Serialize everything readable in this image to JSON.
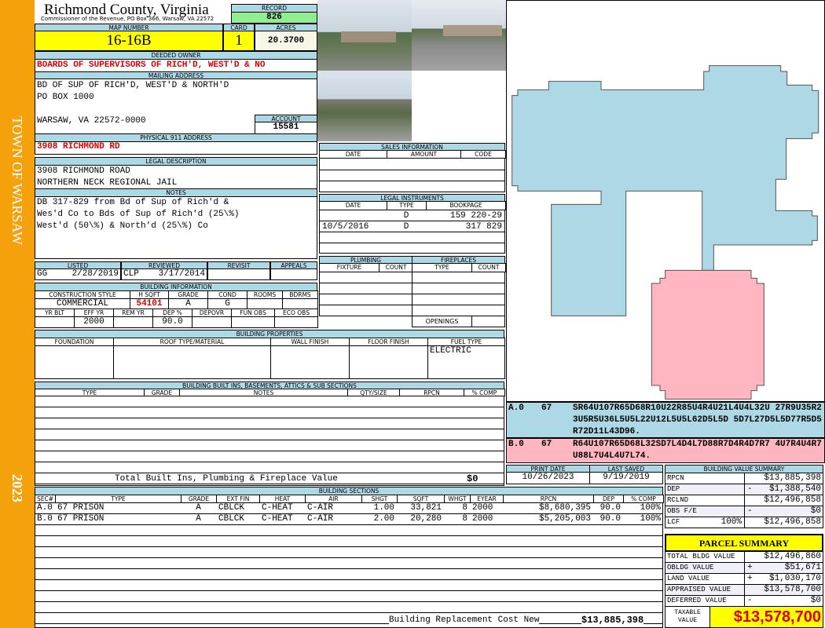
{
  "sidebar": {
    "town": "TOWN OF WARSAW",
    "year": "2023"
  },
  "header": {
    "title": "Richmond County, Virginia",
    "subtitle": "Commissioner of the Revenue, PO Box 366, Warsaw, VA 22572",
    "record_label": "RECORD",
    "record": "826"
  },
  "parcel": {
    "map_label": "MAP NUMBER",
    "map": "16-16B",
    "card_label": "CARD",
    "card": "1",
    "acres_label": "ACRES",
    "acres": "20.3700"
  },
  "owner": {
    "label": "DEEDED OWNER",
    "value": "BOARDS OF SUPERVISORS OF RICH'D, WEST'D & NO"
  },
  "mailing": {
    "label": "MAILING ADDRESS",
    "line1": "BD OF SUP OF RICH'D, WEST'D & NORTH'D",
    "line2": "PO BOX 1000",
    "line3": "WARSAW, VA 22572-0000",
    "account_label": "ACCOUNT",
    "account": "15581"
  },
  "physical": {
    "label": "PHYSICAL 911 ADDRESS",
    "value": "3908 RICHMOND RD"
  },
  "legal": {
    "label": "LEGAL DESCRIPTION",
    "line1": "3908 RICHMOND ROAD",
    "line2": "NORTHERN NECK REGIONAL JAIL"
  },
  "notes": {
    "label": "NOTES",
    "line1": "DB 317-829 from Bd of Sup of Rich'd &",
    "line2": "Wes'd Co to Bds of Sup of Rich'd (25\\%)",
    "line3": "West'd (50\\%) & North'd (25\\%) Co"
  },
  "review": {
    "listed_label": "LISTED",
    "listed_by": "GG",
    "listed_date": "2/28/2019",
    "reviewed_label": "REVIEWED",
    "reviewed_by": "CLP",
    "reviewed_date": "3/17/2014",
    "revisit_label": "REVISIT",
    "appeals_label": "APPEALS"
  },
  "building_info": {
    "label": "BUILDING INFORMATION",
    "h1": [
      "CONSTRUCTION STYLE",
      "H SQFT",
      "GRADE",
      "COND",
      "ROOMS",
      "BDRMS"
    ],
    "v1": [
      "COMMERCIAL",
      "54101",
      "A",
      "G",
      "",
      ""
    ],
    "h2": [
      "YR BLT",
      "EFF YR",
      "REM YR",
      "DEP %",
      "DEPOVR",
      "FUN OBS",
      "ECO OBS"
    ],
    "v2": [
      "",
      "2000",
      "",
      "90.0",
      "",
      "",
      ""
    ]
  },
  "sales": {
    "label": "SALES INFORMATION",
    "headers": [
      "DATE",
      "AMOUNT",
      "CODE"
    ]
  },
  "instruments": {
    "label": "LEGAL INSTRUMENTS",
    "headers": [
      "DATE",
      "TYPE",
      "BOOKPAGE"
    ],
    "rows": [
      [
        "",
        "D",
        "159 220-29"
      ],
      [
        "10/5/2016",
        "D",
        "317 829"
      ]
    ]
  },
  "plumbing": {
    "label": "PLUMBING",
    "headers": [
      "FIXTURE",
      "COUNT"
    ]
  },
  "fireplaces": {
    "label": "FIREPLACES",
    "headers": [
      "TYPE",
      "COUNT"
    ],
    "openings": "OPENINGS"
  },
  "properties": {
    "label": "BUILDING PROPERTIES",
    "headers": [
      "FOUNDATION",
      "ROOF TYPE/MATERIAL",
      "WALL FINISH",
      "FLOOR FINISH",
      "FUEL TYPE"
    ],
    "fuel": "ELECTRIC"
  },
  "builtins": {
    "label": "BUILDING BUILT INS, BASEMENTS, ATTICS & SUB SECTIONS",
    "headers": [
      "TYPE",
      "GRADE",
      "NOTES",
      "QTY/SIZE",
      "RPCN",
      "% COMP"
    ],
    "total_label": "Total Built Ins, Plumbing & Fireplace Value",
    "total": "$0"
  },
  "sections": {
    "label": "BUILDING SECTIONS",
    "headers": [
      "SEC#",
      "TYPE",
      "GRADE",
      "EXT FIN",
      "HEAT",
      "AIR",
      "SHGT",
      "SQFT",
      "WHGT",
      "EYEAR",
      "RPCN",
      "DEP",
      "% COMP"
    ],
    "rows": [
      [
        "A.0",
        "67 PRISON",
        "A",
        "CBLCK",
        "C-HEAT",
        "C-AIR",
        "1.00",
        "33,821",
        "8",
        "2000",
        "$8,680,395",
        "90.0",
        "100%"
      ],
      [
        "B.0",
        "67 PRISON",
        "A",
        "CBLCK",
        "C-HEAT",
        "C-AIR",
        "2.00",
        "20,280",
        "8",
        "2000",
        "$5,205,003",
        "90.0",
        "100%"
      ]
    ],
    "rcn_label": "Building Replacement Cost New",
    "rcn": "$13,885,398"
  },
  "sketch_codes": [
    {
      "sec": "A.0",
      "code": "67",
      "text": "SR64U107R65D68R10U22R85U4R4U21L4U4L32U 27R9U35R23U5R5U36L5U5L22U12L5U5L62D5L5D 5D7L27D5L5D77R5D5R72D11L43D96.",
      "color": "#add8e6"
    },
    {
      "sec": "B.0",
      "code": "67",
      "text": "R64U107R65D68L32SD7L4D4L7D88R7D4R4D7R7 4U7R4U4R7U88L7U4L4U7L74.",
      "color": "#ffb6c1"
    }
  ],
  "dates": {
    "print_label": "PRINT DATE",
    "print": "10/26/2023",
    "saved_label": "LAST SAVED",
    "saved": "9/19/2019"
  },
  "value_summary": {
    "label": "BUILDING VALUE SUMMARY",
    "rows": [
      {
        "k": "RPCN",
        "s": "",
        "v": "$13,885,398"
      },
      {
        "k": "DEP",
        "s": "-",
        "v": "$1,388,540"
      },
      {
        "k": "RCLND",
        "s": "",
        "v": "$12,496,858"
      },
      {
        "k": "OBS F/E",
        "s": "-",
        "v": "$0"
      },
      {
        "k": "LCF",
        "p": "100%",
        "s": "",
        "v": "$12,496,858"
      }
    ]
  },
  "parcel_summary": {
    "title": "PARCEL SUMMARY",
    "rows": [
      {
        "k": "TOTAL BLDG VALUE",
        "s": "",
        "v": "$12,496,860"
      },
      {
        "k": "OBLDG VALUE",
        "s": "+",
        "v": "$51,671"
      },
      {
        "k": "LAND VALUE",
        "s": "+",
        "v": "$1,030,170"
      },
      {
        "k": "APPRAISED VALUE",
        "s": "",
        "v": "$13,578,700"
      },
      {
        "k": "DEFERRED VALUE",
        "s": "-",
        "v": "$0"
      }
    ],
    "taxable_label": "TAXABLE VALUE",
    "taxable": "$13,578,700"
  },
  "colors": {
    "sidebar": "#f5a10c",
    "label": "#add8e6",
    "highlight": "#ffff00",
    "record": "#90ee90",
    "section_a": "#add8e6",
    "section_b": "#ffb6c1",
    "red": "#dd0000"
  }
}
